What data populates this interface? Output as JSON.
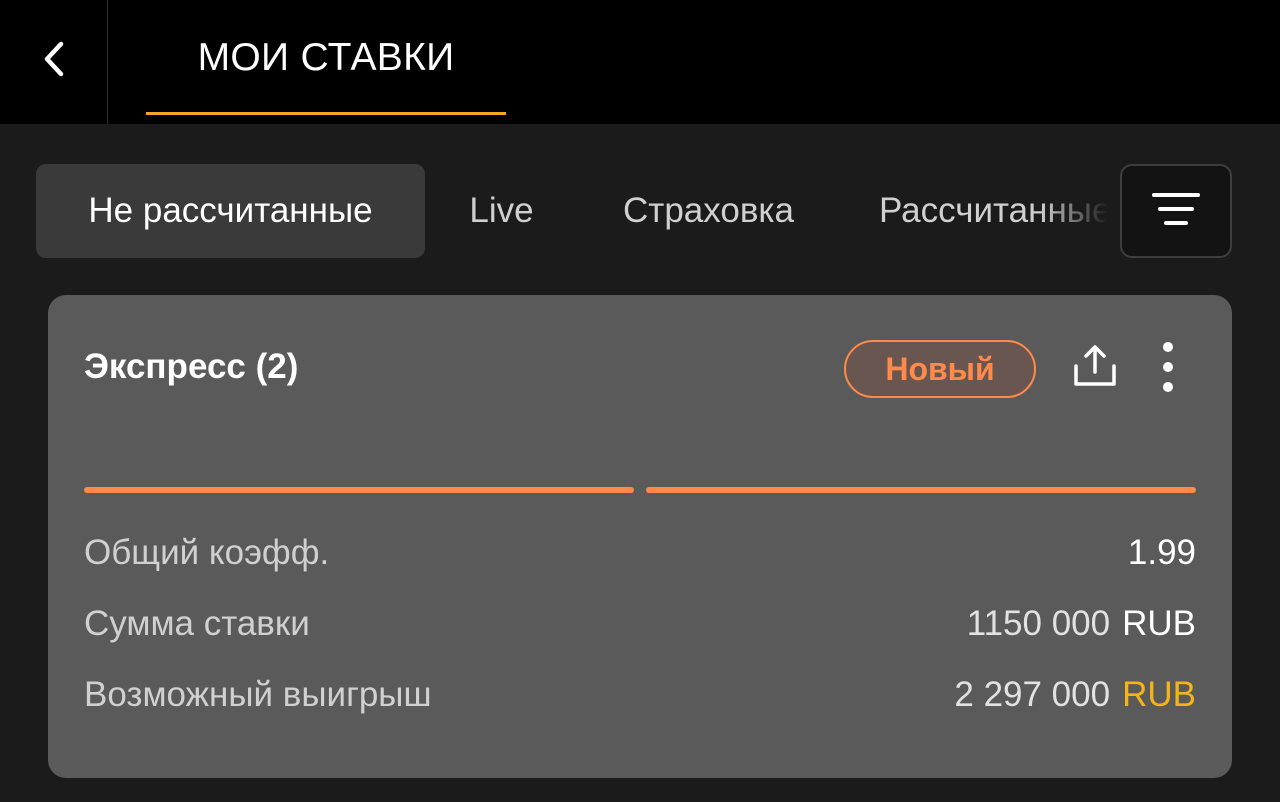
{
  "header": {
    "back_icon": "chevron-left-icon",
    "title": "МОИ СТАВКИ",
    "accent_color": "#f5a524"
  },
  "tabs": [
    {
      "label": "Не рассчитанные",
      "active": true
    },
    {
      "label": "Live",
      "active": false
    },
    {
      "label": "Страховка",
      "active": false
    },
    {
      "label": "Рассчитанные",
      "active": false
    }
  ],
  "filter_icon": "filter-lines-icon",
  "bet_card": {
    "title": "Экспресс (2)",
    "badge": "Новый",
    "badge_color": "#ff8a4a",
    "share_icon": "share-upload-icon",
    "more_icon": "more-vertical-icon",
    "progress_segments": 2,
    "rows": [
      {
        "label": "Общий коэфф.",
        "value": "1.99",
        "currency": ""
      },
      {
        "label": "Сумма ставки",
        "value": "1150 000",
        "currency": "RUB"
      },
      {
        "label": "Возможный выигрыш",
        "value": "2 297 000",
        "currency": "RUB"
      }
    ],
    "win_currency_color": "#f5b41a"
  }
}
